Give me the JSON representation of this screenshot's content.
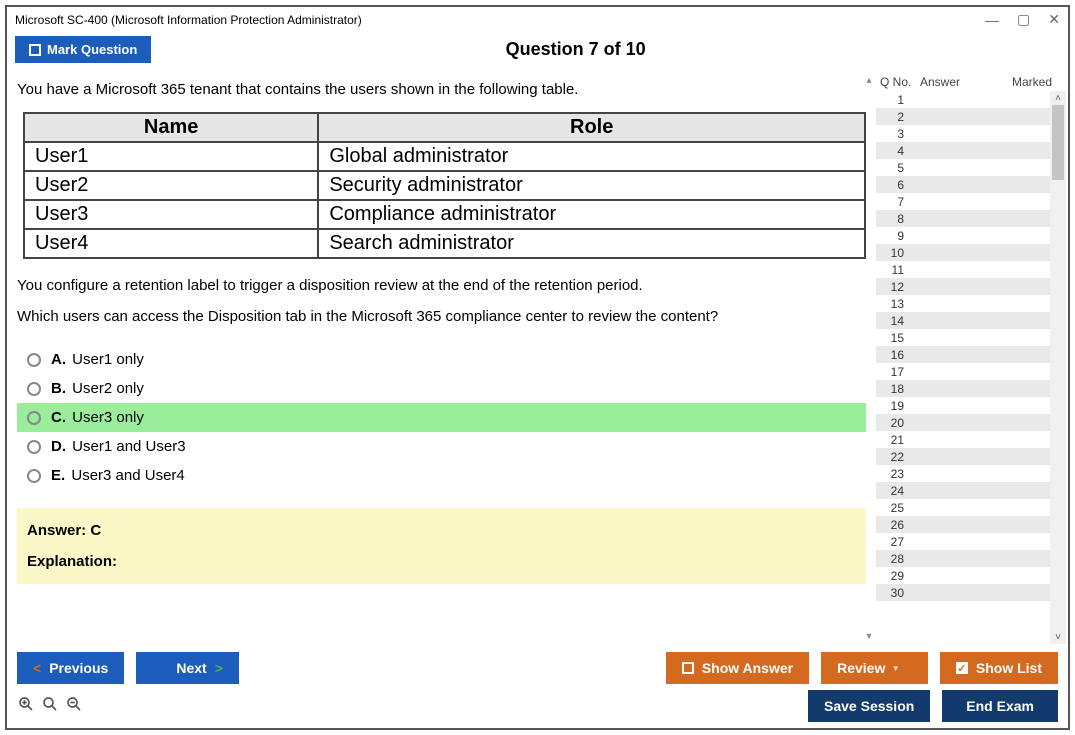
{
  "window": {
    "title": "Microsoft SC-400 (Microsoft Information Protection Administrator)"
  },
  "header": {
    "mark_label": "Mark Question",
    "question_title": "Question 7 of 10"
  },
  "question": {
    "intro": "You have a Microsoft 365 tenant that contains the users shown in the following table.",
    "table": {
      "headers": [
        "Name",
        "Role"
      ],
      "rows": [
        [
          "User1",
          "Global administrator"
        ],
        [
          "User2",
          "Security administrator"
        ],
        [
          "User3",
          "Compliance administrator"
        ],
        [
          "User4",
          "Search administrator"
        ]
      ]
    },
    "line2": "You configure a retention label to trigger a disposition review at the end of the retention period.",
    "line3": "Which users can access the Disposition tab in the Microsoft 365 compliance center to review the content?",
    "options": [
      {
        "letter": "A.",
        "text": "User1 only",
        "selected": false
      },
      {
        "letter": "B.",
        "text": "User2 only",
        "selected": false
      },
      {
        "letter": "C.",
        "text": "User3 only",
        "selected": true
      },
      {
        "letter": "D.",
        "text": "User1 and User3",
        "selected": false
      },
      {
        "letter": "E.",
        "text": "User3 and User4",
        "selected": false
      }
    ],
    "answer_label": "Answer: C",
    "explanation_label": "Explanation:"
  },
  "qlist": {
    "headers": [
      "Q No.",
      "Answer",
      "Marked"
    ],
    "rows": [
      1,
      2,
      3,
      4,
      5,
      6,
      7,
      8,
      9,
      10,
      11,
      12,
      13,
      14,
      15,
      16,
      17,
      18,
      19,
      20,
      21,
      22,
      23,
      24,
      25,
      26,
      27,
      28,
      29,
      30
    ]
  },
  "toolbar": {
    "previous": "Previous",
    "next": "Next",
    "show_answer": "Show Answer",
    "review": "Review",
    "show_list": "Show List",
    "save_session": "Save Session",
    "end_exam": "End Exam"
  }
}
